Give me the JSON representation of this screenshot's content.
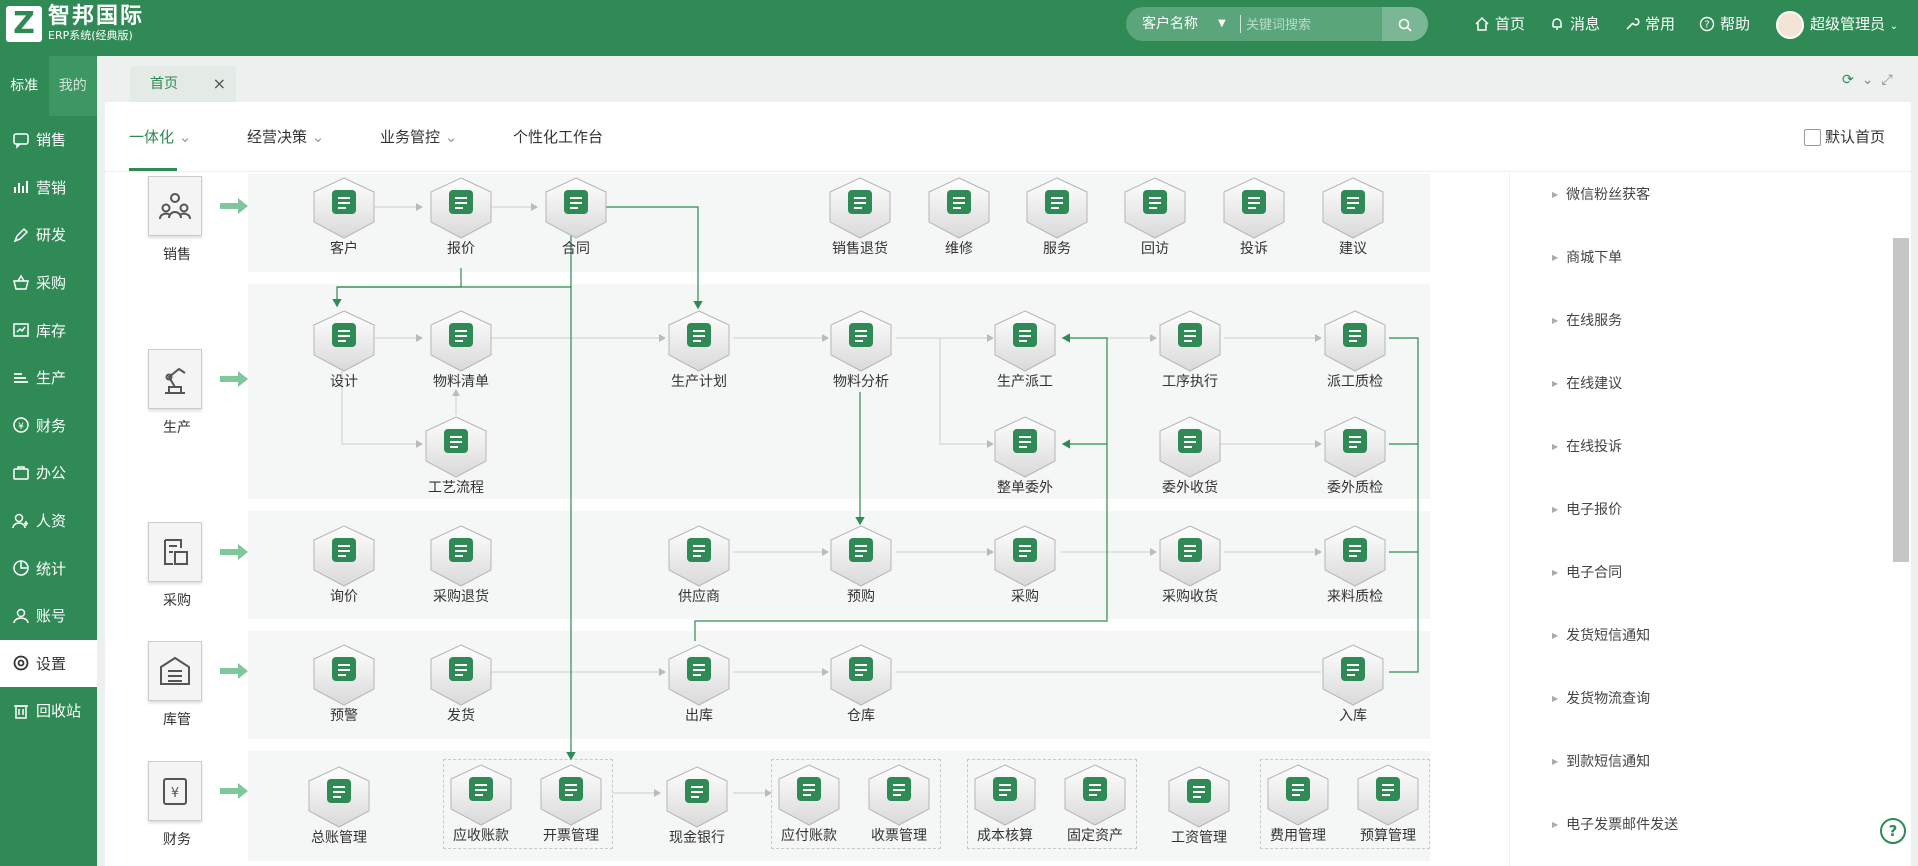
{
  "header": {
    "logo_letter": "Z",
    "brand_name": "智邦国际",
    "brand_sub": "ERP系统(经典版)",
    "search_scope": "客户名称",
    "search_placeholder": "关键词搜索",
    "nav": [
      "首页",
      "消息",
      "常用",
      "帮助"
    ],
    "user": "超级管理员"
  },
  "sidebar": {
    "tabs": [
      "标准",
      "我的"
    ],
    "items": [
      "销售",
      "营销",
      "研发",
      "采购",
      "库存",
      "生产",
      "财务",
      "办公",
      "人资",
      "统计",
      "账号",
      "设置",
      "回收站"
    ],
    "active": "设置"
  },
  "tabbar": {
    "home_tab": "首页",
    "close": "×"
  },
  "subtabs": {
    "items": [
      "一体化",
      "经营决策",
      "业务管控",
      "个性化工作台"
    ],
    "active": "一体化",
    "default_home_label": "默认首页"
  },
  "flow": {
    "categories": [
      "销售",
      "生产",
      "采购",
      "库管",
      "财务"
    ],
    "sales": [
      "客户",
      "报价",
      "合同",
      "销售退货",
      "维修",
      "服务",
      "回访",
      "投诉",
      "建议"
    ],
    "production": [
      "设计",
      "物料清单",
      "生产计划",
      "物料分析",
      "生产派工",
      "工序执行",
      "派工质检",
      "工艺流程",
      "整单委外",
      "委外收货",
      "委外质检"
    ],
    "purchase": [
      "询价",
      "采购退货",
      "供应商",
      "预购",
      "采购",
      "采购收货",
      "来料质检"
    ],
    "warehouse": [
      "预警",
      "发货",
      "出库",
      "仓库",
      "入库"
    ],
    "finance": [
      "总账管理",
      "应收账款",
      "开票管理",
      "现金银行",
      "应付账款",
      "收票管理",
      "成本核算",
      "固定资产",
      "工资管理",
      "费用管理",
      "预算管理"
    ]
  },
  "right_list": [
    "微信粉丝获客",
    "商城下单",
    "在线服务",
    "在线建议",
    "在线投诉",
    "电子报价",
    "电子合同",
    "发货短信通知",
    "发货物流查询",
    "到款短信通知",
    "电子发票邮件发送"
  ],
  "colors": {
    "brand": "#2f8a55",
    "icon_bg": "#2f8a55"
  }
}
